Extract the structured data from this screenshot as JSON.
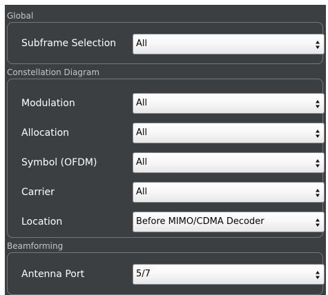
{
  "sections": {
    "global": {
      "title": "Global",
      "subframe_selection": {
        "label": "Subframe Selection",
        "value": "All"
      }
    },
    "constellation": {
      "title": "Constellation Diagram",
      "modulation": {
        "label": "Modulation",
        "value": "All"
      },
      "allocation": {
        "label": "Allocation",
        "value": "All"
      },
      "symbol": {
        "label": "Symbol (OFDM)",
        "value": "All"
      },
      "carrier": {
        "label": "Carrier",
        "value": "All"
      },
      "location": {
        "label": "Location",
        "value": "Before MIMO/CDMA Decoder"
      }
    },
    "beamforming": {
      "title": "Beamforming",
      "antenna_port": {
        "label": "Antenna Port",
        "value": "5/7"
      }
    }
  },
  "icons": {
    "dropdown": "updown-arrows-icon"
  },
  "colors": {
    "panel_background": "#3c3f42",
    "group_border": "#75797d",
    "section_title": "#c4c6c8",
    "label_text": "#ffffff",
    "select_background": "#f5f5f5"
  }
}
